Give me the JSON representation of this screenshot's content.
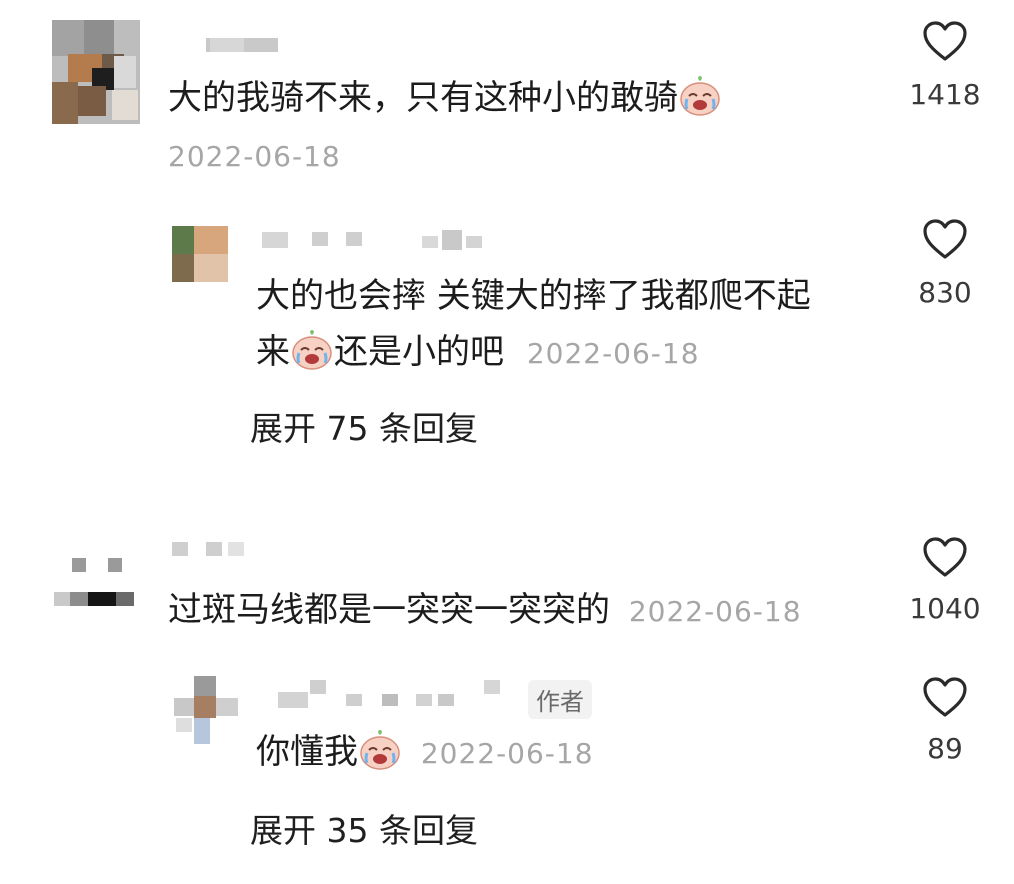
{
  "comments": [
    {
      "text": "大的我骑不来，只有这种小的敢骑",
      "date": "2022-06-18",
      "likes": "1418"
    },
    {
      "line1": "大的也会摔 关键大的摔了我都爬不起",
      "line2": "来",
      "line2b": "还是小的吧",
      "date": "2022-06-18",
      "likes": "830",
      "expand": "展开 75 条回复"
    },
    {
      "text": "过斑马线都是一突突一突突的",
      "date": "2022-06-18",
      "likes": "1040"
    },
    {
      "author_tag": "作者",
      "text": "你懂我",
      "date": "2022-06-18",
      "likes": "89",
      "expand": "展开 35 条回复"
    }
  ],
  "icons": {
    "like": "heart-outline-icon",
    "emoji": "crying-laughing-face-icon"
  },
  "colors": {
    "text": "#1c1c1c",
    "date": "#a6a6a6",
    "heart": "#2a2a2a"
  }
}
